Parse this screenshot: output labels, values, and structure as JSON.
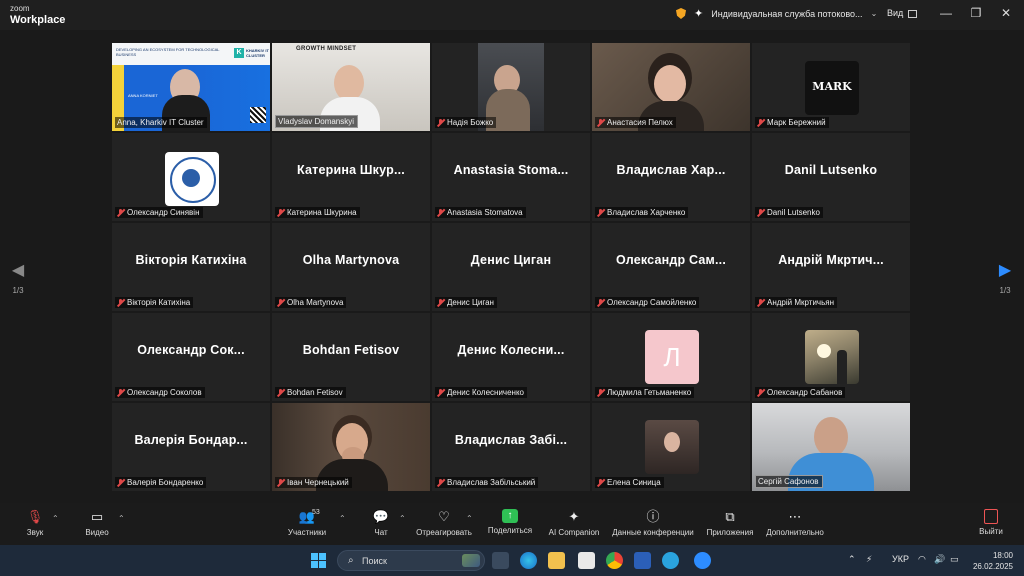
{
  "app": {
    "logo_line1": "zoom",
    "logo_line2": "Workplace"
  },
  "titlebar": {
    "meeting_title": "Индивидуальная служба потоково...",
    "view_label": "Вид",
    "minimize": "—",
    "restore": "❐",
    "close": "✕"
  },
  "pager": {
    "prev": "1/3",
    "next": "1/3"
  },
  "tiles": [
    {
      "label": "Anna, Kharkiv IT Cluster"
    },
    {
      "label": "Vladyslav Domanskyi"
    },
    {
      "label": "Надія Божко"
    },
    {
      "label": "Анастасия Пелюх"
    },
    {
      "label": "Марк Бережний"
    },
    {
      "label": "Олександр Синявін"
    },
    {
      "display": "Катерина  Шкур...",
      "label": "Катерина Шкурина"
    },
    {
      "display": "Anastasia  Stoma...",
      "label": "Anastasia Stomatova"
    },
    {
      "display": "Владислав  Хар...",
      "label": "Владислав Харченко"
    },
    {
      "display": "Danil Lutsenko",
      "label": "Danil Lutsenko"
    },
    {
      "display": "Вікторія  Катихіна",
      "label": "Вікторія Катихіна"
    },
    {
      "display": "Olha Martynova",
      "label": "Olha Martynova"
    },
    {
      "display": "Денис  Циган",
      "label": "Денис Циган"
    },
    {
      "display": "Олександр  Сам...",
      "label": "Олександр Самойленко"
    },
    {
      "display": "Андрій  Мкртич...",
      "label": "Андрій Мкртичьян"
    },
    {
      "display": "Олександр  Сок...",
      "label": "Олександр Соколов"
    },
    {
      "display": "Bohdan Fetisov",
      "label": "Bohdan Fetisov"
    },
    {
      "display": "Денис  Колесни...",
      "label": "Денис Колесниченко"
    },
    {
      "avatar_letter": "Л",
      "label": "Людмила Гетьманенко"
    },
    {
      "label": "Олександр Сабанов"
    },
    {
      "display": "Валерія  Бондар...",
      "label": "Валерія Бондаренко"
    },
    {
      "label": "Іван Чернецький"
    },
    {
      "display": "Владислав  Забі...",
      "label": "Владислав Забільський"
    },
    {
      "label": "Елена Синица"
    },
    {
      "label": "Сергій Сафонов"
    }
  ],
  "avatar_mark_text": "MARK",
  "slide": {
    "header": "DEVELOPING AN ECOSYSTEM FOR TECHNOLOGICAL BUSINESS",
    "brand": "KHARKIV IT CLUSTER",
    "speaker": "ANNA KORNIET"
  },
  "gm_title": "GROWTH MINDSET",
  "toolbar": {
    "audio": "Звук",
    "video": "Видео",
    "participants": "Участники",
    "participants_count": "53",
    "chat": "Чат",
    "react": "Отреагировать",
    "share": "Поделиться",
    "ai": "AI Companion",
    "info": "Данные конференции",
    "apps": "Приложения",
    "more": "Дополнительно",
    "leave": "Выйти"
  },
  "taskbar": {
    "search_placeholder": "Поиск",
    "lang": "УКР",
    "time": "18:00",
    "date": "26.02.2025"
  },
  "colors": {
    "active_speaker": "#3ccf5b",
    "share": "#2fbf55",
    "muted": "#e04848",
    "accent": "#0e72ed"
  }
}
